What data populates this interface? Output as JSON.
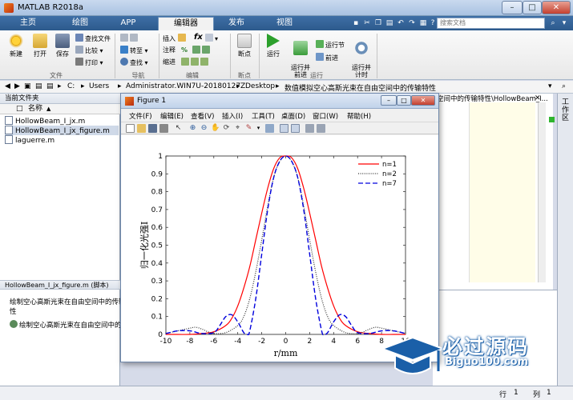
{
  "window": {
    "title": "MATLAB R2018a",
    "min": "–",
    "max": "□",
    "close": "✕"
  },
  "tabs": [
    {
      "label": "主页"
    },
    {
      "label": "绘图"
    },
    {
      "label": "APP"
    },
    {
      "label": "编辑器"
    },
    {
      "label": "发布"
    },
    {
      "label": "视图"
    }
  ],
  "search": {
    "placeholder": "搜索文档"
  },
  "ribbon": {
    "new": "新建",
    "open": "打开",
    "save": "保存",
    "find_files": "查找文件",
    "compare": "比较",
    "print": "打印",
    "goto": "转至",
    "find": "查找",
    "insert": "插入",
    "fx": "fx",
    "comment": "注释",
    "pct": "%",
    "indent": "缩进",
    "breakpoints": "断点",
    "run": "运行",
    "run_advance": "运行并\n前进",
    "run_section": "运行节",
    "advance": "前进",
    "run_time": "运行并\n计时",
    "groups": {
      "file": "文件",
      "nav": "导航",
      "edit": "编辑",
      "bp": "断点",
      "run": "运行"
    }
  },
  "address": {
    "path": [
      "C:",
      "Users",
      "Administrator.WIN7U-20180127Z",
      "Desktop",
      "数值模拟空心高斯光束在自由空间中的传输特性"
    ]
  },
  "filepanel": {
    "title": "当前文件夹",
    "col_name": "名称",
    "files": [
      {
        "name": "HollowBeam_I_jx.m",
        "selected": false
      },
      {
        "name": "HollowBeam_I_jx_figure.m",
        "selected": true
      },
      {
        "name": "laguerre.m",
        "selected": false
      }
    ],
    "detail_title": "HollowBeam_I_jx_figure.m  (脚本)",
    "detail_line1": "绘制空心高斯光束在自由空间中的传输",
    "detail_line2": "性",
    "detail_item": "绘制空心高斯光束在自由空间中的"
  },
  "editor": {
    "tabtitle": "空间中的传输特性\\HollowBeam_I..."
  },
  "side_label": "工作区",
  "status": {
    "row_label": "行",
    "row": "1",
    "col_label": "列",
    "col": "1"
  },
  "figure": {
    "title": "Figure 1",
    "menu": [
      "文件(F)",
      "编辑(E)",
      "查看(V)",
      "插入(I)",
      "工具(T)",
      "桌面(D)",
      "窗口(W)",
      "帮助(H)"
    ]
  },
  "chart_data": {
    "type": "line",
    "xlabel": "r/mm",
    "ylabel": "归一化光强I",
    "xlim": [
      -10,
      10
    ],
    "ylim": [
      0,
      1
    ],
    "xticks": [
      -10,
      -8,
      -6,
      -4,
      -2,
      0,
      2,
      4,
      6,
      8,
      10
    ],
    "yticks": [
      0,
      0.1,
      0.2,
      0.3,
      0.4,
      0.5,
      0.6,
      0.7,
      0.8,
      0.9,
      1
    ],
    "legend_position": "top-right",
    "series": [
      {
        "name": "n=1",
        "color": "#ff0000",
        "style": "solid",
        "x": [
          -10,
          -9,
          -8,
          -7,
          -6,
          -5,
          -4.5,
          -4,
          -3.5,
          -3,
          -2.5,
          -2,
          -1.5,
          -1,
          -0.5,
          0,
          0.5,
          1,
          1.5,
          2,
          2.5,
          3,
          3.5,
          4,
          4.5,
          5,
          6,
          7,
          8,
          9,
          10
        ],
        "y": [
          0,
          0,
          0,
          0.005,
          0.015,
          0.05,
          0.09,
          0.16,
          0.26,
          0.38,
          0.53,
          0.68,
          0.82,
          0.93,
          0.99,
          1,
          0.99,
          0.93,
          0.82,
          0.68,
          0.53,
          0.38,
          0.26,
          0.16,
          0.09,
          0.05,
          0.015,
          0.005,
          0,
          0,
          0
        ]
      },
      {
        "name": "n=2",
        "color": "#333333",
        "style": "dotted",
        "x": [
          -10,
          -9,
          -8,
          -7.5,
          -7,
          -6.5,
          -6,
          -5,
          -4,
          -3.5,
          -3,
          -2.5,
          -2,
          -1.5,
          -1,
          -0.5,
          0,
          0.5,
          1,
          1.5,
          2,
          2.5,
          3,
          3.5,
          4,
          5,
          6,
          6.5,
          7,
          7.5,
          8,
          9,
          10
        ],
        "y": [
          0.005,
          0.02,
          0.035,
          0.04,
          0.03,
          0.015,
          0.005,
          0.01,
          0.05,
          0.1,
          0.2,
          0.35,
          0.53,
          0.72,
          0.88,
          0.97,
          1,
          0.97,
          0.88,
          0.72,
          0.53,
          0.35,
          0.2,
          0.1,
          0.05,
          0.01,
          0.005,
          0.015,
          0.03,
          0.04,
          0.035,
          0.02,
          0.005
        ]
      },
      {
        "name": "n=7",
        "color": "#0000dd",
        "style": "dashed",
        "x": [
          -10,
          -9,
          -8,
          -7,
          -6,
          -5.5,
          -5,
          -4.5,
          -4,
          -3.5,
          -3.2,
          -3,
          -2.5,
          -2,
          -1.5,
          -1,
          -0.5,
          0,
          0.5,
          1,
          1.5,
          2,
          2.5,
          3,
          3.2,
          3.5,
          4,
          4.5,
          5,
          5.5,
          6,
          7,
          8,
          9,
          10
        ],
        "y": [
          0.005,
          0.02,
          0.02,
          0.005,
          0.01,
          0.05,
          0.1,
          0.11,
          0.07,
          0.01,
          0,
          0.02,
          0.2,
          0.45,
          0.7,
          0.88,
          0.97,
          1,
          0.97,
          0.88,
          0.7,
          0.45,
          0.2,
          0.02,
          0,
          0.01,
          0.07,
          0.11,
          0.1,
          0.05,
          0.01,
          0.005,
          0.02,
          0.02,
          0.005
        ]
      }
    ]
  },
  "watermark": {
    "cn": "必过源码",
    "en": "Biguo100.com"
  }
}
